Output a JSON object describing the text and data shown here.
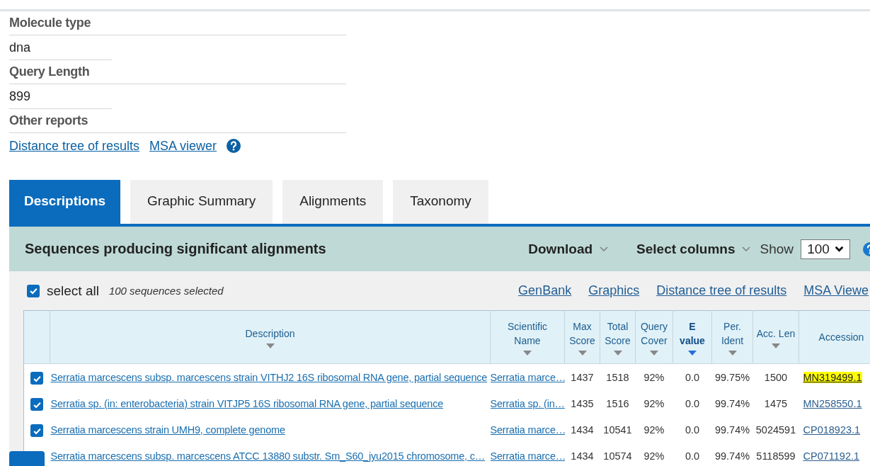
{
  "info": [
    {
      "label": "Molecule type",
      "value": "dna"
    },
    {
      "label": "Query Length",
      "value": "899"
    },
    {
      "label": "Other reports"
    }
  ],
  "report_links": [
    "Distance tree of results",
    "MSA viewer"
  ],
  "tabs": [
    {
      "label": "Descriptions",
      "selected": true
    },
    {
      "label": "Graphic Summary",
      "selected": false
    },
    {
      "label": "Alignments",
      "selected": false
    },
    {
      "label": "Taxonomy",
      "selected": false
    }
  ],
  "panel": {
    "title": "Sequences producing significant alignments",
    "menus": [
      "Download",
      "Select columns"
    ],
    "show_label": "Show",
    "show_value": "100"
  },
  "selection": {
    "checked": true,
    "label": "select all",
    "count": "100 sequences selected"
  },
  "toolbar_links": [
    "GenBank",
    "Graphics",
    "Distance tree of results",
    "MSA Viewe"
  ],
  "table": {
    "columns": [
      {
        "label": "Description",
        "sortable": true,
        "sorted": false
      },
      {
        "label": "Scientific Name",
        "sortable": true,
        "sorted": false
      },
      {
        "label": "Max Score",
        "sortable": true,
        "sorted": false
      },
      {
        "label": "Total Score",
        "sortable": true,
        "sorted": false
      },
      {
        "label": "Query Cover",
        "sortable": true,
        "sorted": false
      },
      {
        "label": "E value",
        "sortable": true,
        "sorted": true
      },
      {
        "label": "Per. Ident",
        "sortable": true,
        "sorted": false
      },
      {
        "label": "Acc. Len",
        "sortable": true,
        "sorted": false
      },
      {
        "label": "Accession",
        "sortable": false,
        "sorted": false
      }
    ],
    "rows": [
      {
        "checked": true,
        "description": "Serratia marcescens subsp. marcescens strain VITHJ2 16S ribosomal RNA gene, partial sequence",
        "scientific_name": "Serratia marce…",
        "max_score": "1437",
        "total_score": "1518",
        "query_cover": "92%",
        "e_value": "0.0",
        "per_ident": "99.75%",
        "acc_len": "1500",
        "accession": "MN319499.1",
        "highlighted": true
      },
      {
        "checked": true,
        "description": "Serratia sp. (in: enterobacteria) strain VITJP5 16S ribosomal RNA gene, partial sequence",
        "scientific_name": "Serratia sp. (in…",
        "max_score": "1435",
        "total_score": "1516",
        "query_cover": "92%",
        "e_value": "0.0",
        "per_ident": "99.74%",
        "acc_len": "1475",
        "accession": "MN258550.1",
        "highlighted": false
      },
      {
        "checked": true,
        "description": "Serratia marcescens strain UMH9, complete genome",
        "scientific_name": "Serratia marce…",
        "max_score": "1434",
        "total_score": "10541",
        "query_cover": "92%",
        "e_value": "0.0",
        "per_ident": "99.74%",
        "acc_len": "5024591",
        "accession": "CP018923.1",
        "highlighted": false
      },
      {
        "description": "Serratia marcescens subsp. marcescens ATCC 13880 substr. Sm_S60_jyu2015 chromosome, c…",
        "scientific_name": "Serratia marce…",
        "max_score": "1434",
        "total_score": "10574",
        "query_cover": "92%",
        "e_value": "0.0",
        "per_ident": "99.74%",
        "acc_len": "5118599",
        "accession": "CP071192.1",
        "highlighted": false
      }
    ]
  }
}
